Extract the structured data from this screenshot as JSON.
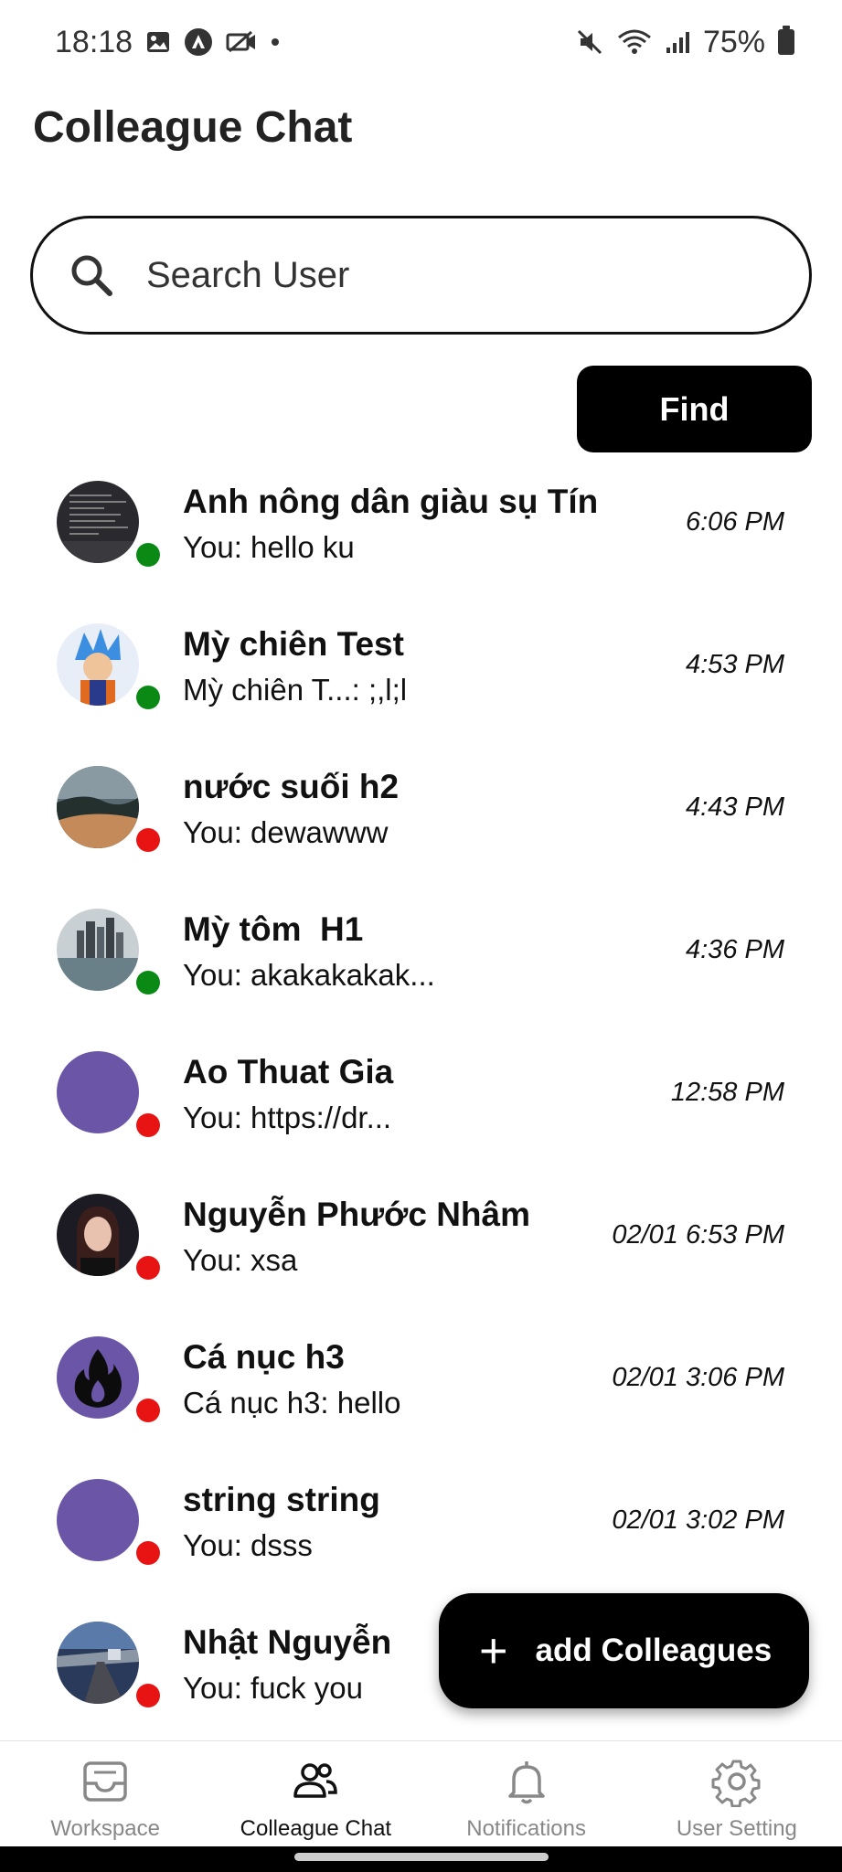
{
  "status_bar": {
    "time": "18:18",
    "battery": "75%",
    "left_icons": [
      "image-icon",
      "arrow-icon",
      "camera-off-icon",
      "dot-icon"
    ],
    "right_icons": [
      "mute-icon",
      "wifi-icon",
      "signal-icon",
      "battery-icon"
    ]
  },
  "header": {
    "title": "Colleague Chat"
  },
  "search": {
    "placeholder": "Search User",
    "value": ""
  },
  "find_button": {
    "label": "Find"
  },
  "colors": {
    "online": "#0a8a14",
    "offline": "#e81414",
    "accent": "#000000",
    "default_avatar": "#6a55a6"
  },
  "chats": [
    {
      "name": "Anh nông dân giàu sụ Tín",
      "preview": "You: hello ku",
      "time": "6:06 PM",
      "status": "online",
      "avatar": "terminal-avatar"
    },
    {
      "name": "Mỳ chiên Test",
      "preview": "Mỳ chiên T...: ;,l;l",
      "time": "4:53 PM",
      "status": "online",
      "avatar": "anime-avatar"
    },
    {
      "name": "nước suối h2",
      "preview": "You: dewawww",
      "time": "4:43 PM",
      "status": "offline",
      "avatar": "desert-avatar"
    },
    {
      "name": "Mỳ tôm  H1",
      "preview": "You: akakakakak...",
      "time": "4:36 PM",
      "status": "online",
      "avatar": "city-avatar"
    },
    {
      "name": "Ao Thuat Gia",
      "preview": "You: https://dr...",
      "time": "12:58 PM",
      "status": "offline",
      "avatar": "default-avatar"
    },
    {
      "name": "Nguyễn Phước Nhâm",
      "preview": "You: xsa",
      "time": "02/01 6:53 PM",
      "status": "offline",
      "avatar": "portrait-avatar"
    },
    {
      "name": "Cá nục h3",
      "preview": "Cá nục h3: hello",
      "time": "02/01 3:06 PM",
      "status": "offline",
      "avatar": "flame-avatar"
    },
    {
      "name": "string string",
      "preview": "You: dsss",
      "time": "02/01 3:02 PM",
      "status": "offline",
      "avatar": "default-avatar"
    },
    {
      "name": "Nhật Nguyễn",
      "preview": "You: fuck you",
      "time": "",
      "status": "offline",
      "avatar": "road-avatar"
    }
  ],
  "fab": {
    "label": "add Colleagues",
    "icon": "plus-icon"
  },
  "bottom_nav": [
    {
      "label": "Workspace",
      "icon": "inbox-icon",
      "active": false
    },
    {
      "label": "Colleague Chat",
      "icon": "people-icon",
      "active": true
    },
    {
      "label": "Notifications",
      "icon": "bell-icon",
      "active": false
    },
    {
      "label": "User Setting",
      "icon": "gear-icon",
      "active": false
    }
  ]
}
